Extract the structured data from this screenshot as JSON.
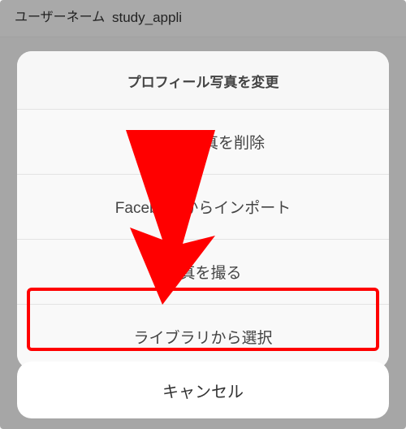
{
  "background": {
    "username_label": "ユーザーネーム",
    "username_value": "study_appli"
  },
  "sheet": {
    "title": "プロフィール写真を変更",
    "items": [
      {
        "label": "現在の写真を削除"
      },
      {
        "label": "Facebookからインポート"
      },
      {
        "label": "写真を撮る"
      },
      {
        "label": "ライブラリから選択"
      }
    ],
    "cancel": "キャンセル"
  },
  "annotation": {
    "arrow_color": "#ff0000",
    "highlight_color": "#ff0000"
  }
}
